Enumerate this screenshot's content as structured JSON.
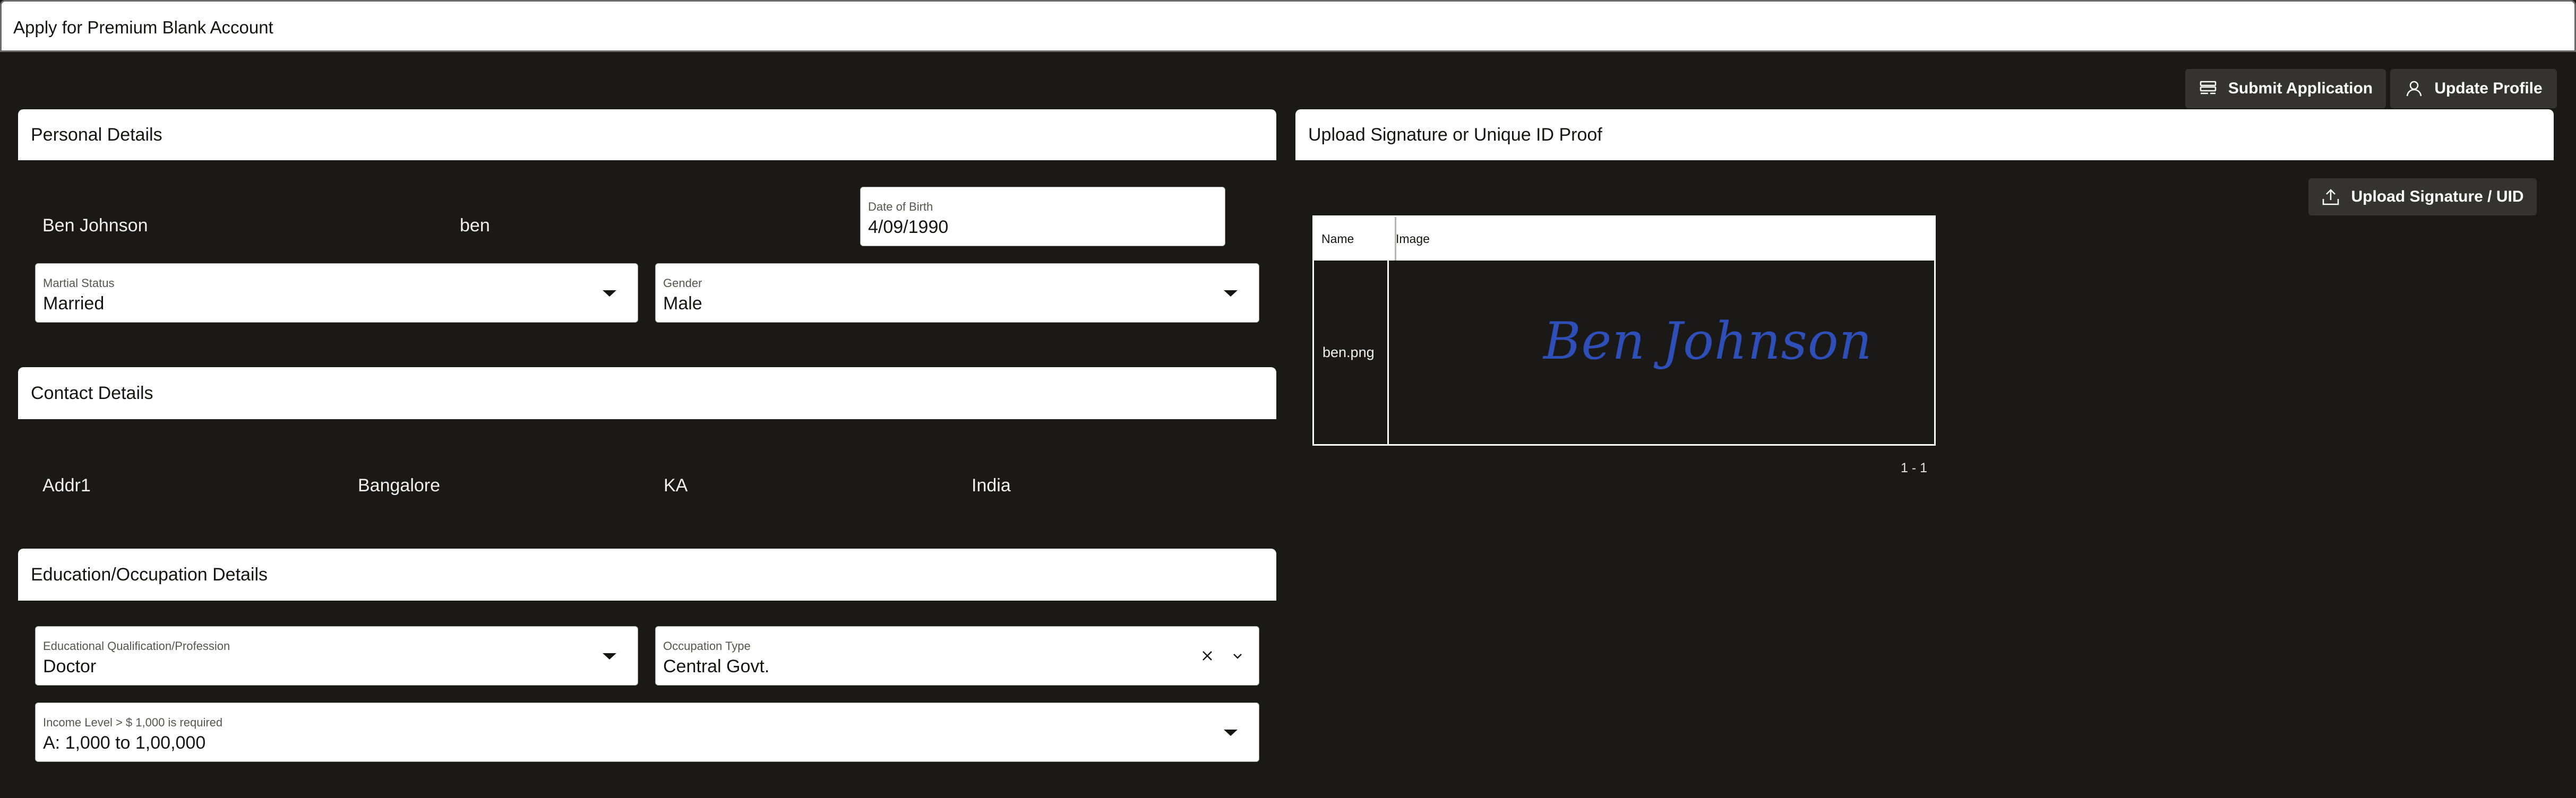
{
  "window": {
    "title": "Apply for Premium Blank Account"
  },
  "toolbar": {
    "submit_label": "Submit Application",
    "update_label": "Update Profile"
  },
  "personal": {
    "heading": "Personal Details",
    "full_name": "Ben Johnson",
    "username": "ben",
    "dob": {
      "label": "Date of Birth",
      "value": "4/09/1990"
    },
    "marital": {
      "label": "Martial Status",
      "value": "Married"
    },
    "gender": {
      "label": "Gender",
      "value": "Male"
    }
  },
  "contact": {
    "heading": "Contact Details",
    "address": "Addr1",
    "city": "Bangalore",
    "state": "KA",
    "country": "India"
  },
  "education": {
    "heading": "Education/Occupation Details",
    "qualification": {
      "label": "Educational Qualification/Profession",
      "value": "Doctor"
    },
    "occupation": {
      "label": "Occupation Type",
      "value": "Central Govt."
    },
    "income": {
      "label": "Income Level > $ 1,000 is required",
      "value": "A: 1,000 to 1,00,000"
    }
  },
  "upload": {
    "heading": "Upload Signature or Unique ID Proof",
    "button_label": "Upload Signature / UID",
    "columns": [
      "Name",
      "Image"
    ],
    "rows": [
      {
        "name": "ben.png",
        "image_text": "Ben Johnson"
      }
    ],
    "pagination": "1 - 1",
    "signature_color": "#2f4fb8"
  },
  "icons": {
    "submit": "stack-icon",
    "update": "user-icon",
    "upload": "upload-icon",
    "dropdown": "caret-down-icon",
    "clear": "close-icon",
    "chevron": "chevron-down-icon"
  }
}
